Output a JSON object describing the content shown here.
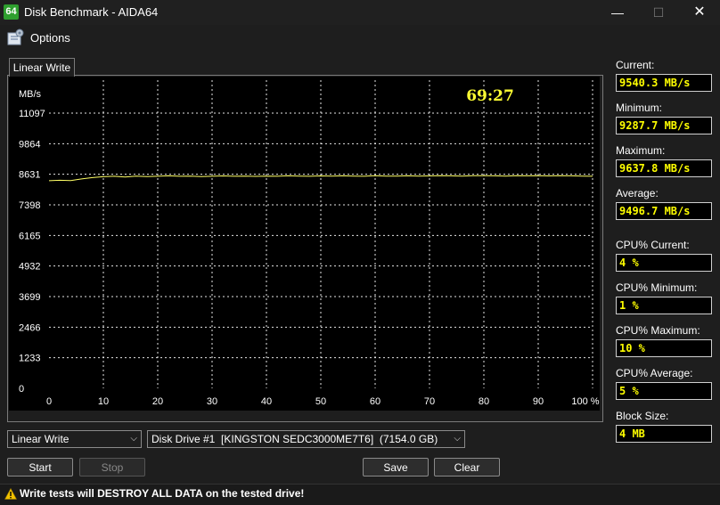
{
  "window": {
    "icon_text": "64",
    "title": "Disk Benchmark - AIDA64",
    "minimize_glyph": "—",
    "maximize_glyph": "☐",
    "close_glyph": "✕"
  },
  "menu": {
    "options_label": "Options",
    "options_icon": "options-icon"
  },
  "tab": {
    "label": "Linear Write"
  },
  "timer": "69:27",
  "colors": {
    "accent_line": "#ffff66",
    "value_text": "#ffff00",
    "grid": "#ffffff",
    "plot_bg": "#000000"
  },
  "chart_data": {
    "type": "line",
    "ylabel": "MB/s",
    "y_ticks": [
      "11097",
      "9864",
      "8631",
      "7398",
      "6165",
      "4932",
      "3699",
      "2466",
      "1233",
      "0"
    ],
    "x_ticks": [
      "0",
      "10",
      "20",
      "30",
      "40",
      "50",
      "60",
      "70",
      "80",
      "90",
      "100 %"
    ],
    "xlim": [
      0,
      100
    ],
    "ylim": [
      0,
      12330
    ],
    "grid": true,
    "series": [
      {
        "x": [
          0,
          2,
          4,
          6,
          8,
          10,
          12,
          14,
          16,
          18,
          20,
          22,
          24,
          26,
          28,
          30,
          32,
          34,
          36,
          38,
          40,
          42,
          44,
          46,
          48,
          50,
          52,
          54,
          56,
          58,
          60,
          62,
          64,
          66,
          68,
          70,
          72,
          74,
          76,
          78,
          80,
          82,
          84,
          86,
          88,
          90,
          92,
          94,
          96,
          98,
          100
        ],
        "values": [
          9300,
          9320,
          9310,
          9380,
          9440,
          9480,
          9500,
          9470,
          9510,
          9490,
          9500,
          9520,
          9500,
          9510,
          9490,
          9500,
          9515,
          9500,
          9505,
          9495,
          9510,
          9500,
          9520,
          9510,
          9500,
          9515,
          9505,
          9520,
          9510,
          9500,
          9525,
          9510,
          9505,
          9520,
          9510,
          9515,
          9530,
          9520,
          9510,
          9525,
          9530,
          9520,
          9510,
          9525,
          9520,
          9530,
          9515,
          9525,
          9520,
          9510,
          9500
        ]
      }
    ]
  },
  "stats": [
    {
      "label": "Current:",
      "value": "9540.3 MB/s"
    },
    {
      "label": "Minimum:",
      "value": "9287.7 MB/s"
    },
    {
      "label": "Maximum:",
      "value": "9637.8 MB/s"
    },
    {
      "label": "Average:",
      "value": "9496.7 MB/s"
    },
    {
      "label": "CPU% Current:",
      "value": "4 %"
    },
    {
      "label": "CPU% Minimum:",
      "value": "1 %"
    },
    {
      "label": "CPU% Maximum:",
      "value": "10 %"
    },
    {
      "label": "CPU% Average:",
      "value": "5 %"
    },
    {
      "label": "Block Size:",
      "value": "4 MB"
    }
  ],
  "controls": {
    "mode_select": "Linear Write",
    "drive_select": "Disk Drive #1  [KINGSTON SEDC3000ME7T6]  (7154.0 GB)",
    "start_label": "Start",
    "stop_label": "Stop",
    "save_label": "Save",
    "clear_label": "Clear",
    "dropdown_glyph": "⌵"
  },
  "status": {
    "warning_text": "Write tests will DESTROY ALL DATA on the tested drive!",
    "warning_icon": "warning-icon"
  }
}
